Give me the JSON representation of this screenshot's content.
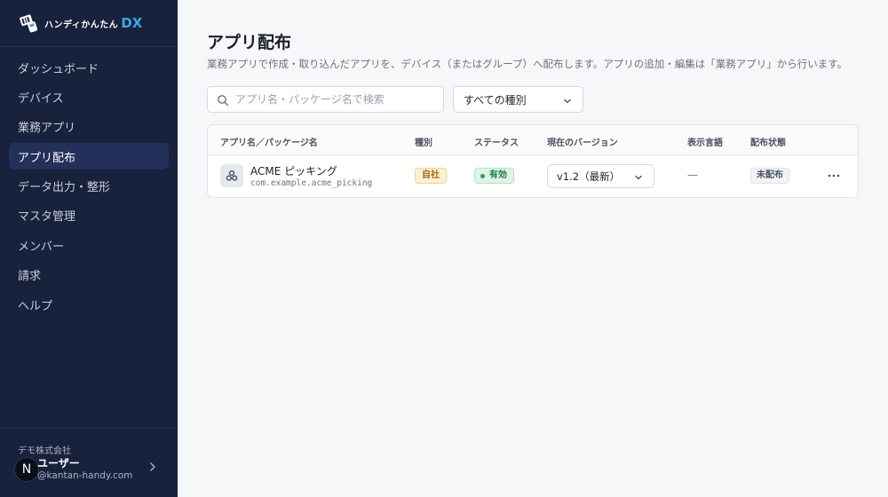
{
  "brand": {
    "name": "ハンディかんたん",
    "suffix": "DX",
    "accent_color": "#3ca8e8",
    "logo_icon": "handy-scanner-logo-icon"
  },
  "sidebar": {
    "background": "#18223d",
    "items": [
      {
        "label": "ダッシュボード",
        "active": false
      },
      {
        "label": "デバイス",
        "active": false
      },
      {
        "label": "業務アプリ",
        "active": false
      },
      {
        "label": "アプリ配布",
        "active": true
      },
      {
        "label": "データ出力・整形",
        "active": false
      },
      {
        "label": "マスタ管理",
        "active": false
      },
      {
        "label": "メンバー",
        "active": false
      },
      {
        "label": "請求",
        "active": false
      },
      {
        "label": "ヘルプ",
        "active": false
      }
    ]
  },
  "user": {
    "org": "デモ株式会社",
    "avatar_letter": "N",
    "name": "ユーザー",
    "email": "@kantan-handy.com",
    "chevron_icon": "chevron-right-icon"
  },
  "page": {
    "title": "アプリ配布",
    "description": "業務アプリで作成・取り込んだアプリを、デバイス（またはグループ）へ配布します。アプリの追加・編集は「業務アプリ」から行います。"
  },
  "filters": {
    "search_placeholder": "アプリ名・パッケージ名で検索",
    "search_value": "",
    "type_select_value": "すべての種別"
  },
  "table": {
    "headers": {
      "name": "アプリ名／パッケージ名",
      "type": "種別",
      "status": "ステータス",
      "version": "現在のバージョン",
      "language": "表示言語",
      "distribution": "配布状態"
    },
    "rows": [
      {
        "icon": "app-cluster-icon",
        "name": "ACME ピッキング",
        "package": "com.example.acme_picking",
        "type": "自社",
        "status": "有効",
        "version": "v1.2（最新）",
        "language": "—",
        "distribution": "未配布"
      }
    ]
  }
}
